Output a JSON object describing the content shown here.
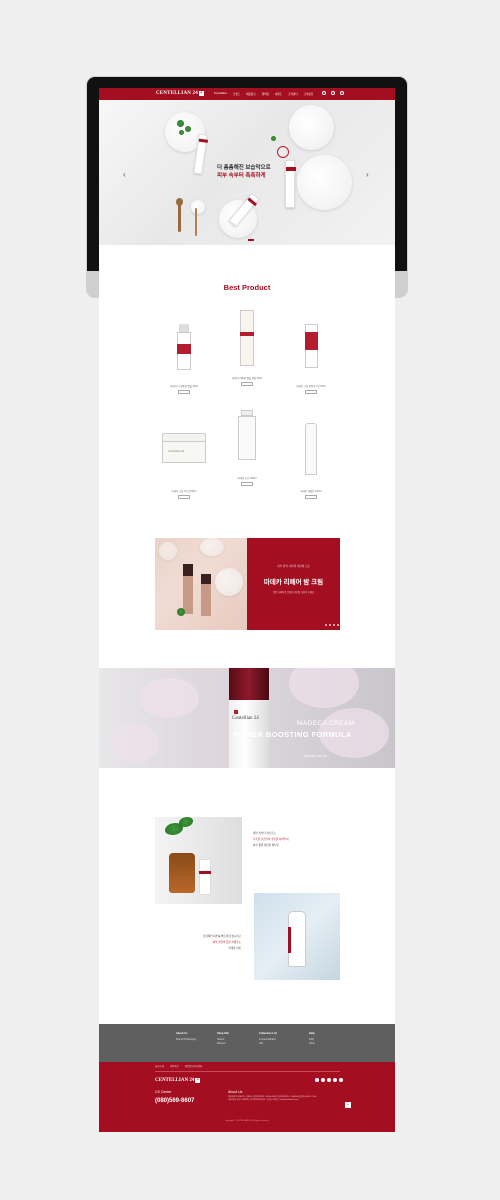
{
  "brand": {
    "logo": "CENTELLIAN 24",
    "logo_mark": "+"
  },
  "nav": {
    "menu": [
      "Foundation",
      "브랜드",
      "제품정보",
      "멤버십",
      "이벤트",
      "고객센터",
      "고객상담"
    ],
    "icons": [
      "user-icon",
      "cart-icon",
      "search-icon"
    ]
  },
  "hero": {
    "line1": "더 촘촘해진 보습막으로",
    "line2": "피부 속부터 촉촉하게",
    "prev": "‹",
    "next": "›"
  },
  "best_product": {
    "title": "Best Product",
    "buy_label": "",
    "items": [
      {
        "name": "마데카 더 에센셜 앰플 30ml"
      },
      {
        "name": "마데카 리페어 앰플 세럼 30ml"
      },
      {
        "name": "마데카 크림 파워부스팅 50ml"
      },
      {
        "name": "마데카 크림 리뉴얼 50ml"
      },
      {
        "name": "마데카 토너 150ml"
      },
      {
        "name": "마데카 에멀전 120ml"
      }
    ]
  },
  "promo": {
    "sub": "피부 장벽, 피부결 개선에 도움",
    "title": "마데카 리페어 밤 크림",
    "desc": "집중 리페어로 건강한 피부를 되찾아 보세요"
  },
  "madeca_banner": {
    "line1": "MADECA CREAM",
    "line2": "POWER BOOSTING FORMULA",
    "brand": "CENTELLIAN 24",
    "bottle_brand": "Centellian 24"
  },
  "lifestyle": {
    "text1": [
      "피부 속부터 차오르는",
      "촉촉한 보습막이 수분을 지켜주어",
      "하루 종일 편안한 피부로"
    ],
    "text2": [
      "민감해진 피부를 빠르게 진정시키고",
      "피부 본연의 힘을 키워주는",
      "마데카 라인"
    ]
  },
  "footer": {
    "cols": [
      {
        "h": "About Us",
        "items": [
          "Brand Philosophy"
        ]
      },
      {
        "h": "Shop Info",
        "items": [
          "Notice",
          "Review"
        ]
      },
      {
        "h": "Collection List",
        "items": [
          "Limited Edition",
          "Gift"
        ]
      },
      {
        "h": "Help",
        "items": [
          "FAQ",
          "Q&A"
        ]
      }
    ],
    "links": [
      "회사소개",
      "이용약관",
      "개인정보처리방침"
    ],
    "logo": "CENTELLIAN 24",
    "cs_title": "CS Center",
    "cs_phone": "(080)569-8607",
    "about_title": "About Us",
    "about_text": "동국제약(주) 대표이사 : 송준호 | 사업자등록번호 : 000-00-00000 | 통신판매업신고 : 제0000-서울강남-00000호 | 주소 : 서울특별시 강남구 테헤란로 | 개인정보관리책임자 : 홍길동 | 이메일 : help@centellian24.com",
    "top": "^",
    "copyright": "Copyright © CENTELLIAN 24. All rights reserved."
  },
  "colors": {
    "brand_red": "#a30f21",
    "footer_grey": "#5f5f5f"
  }
}
